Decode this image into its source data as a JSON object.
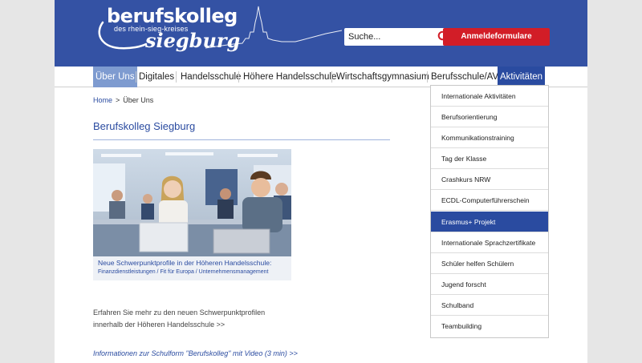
{
  "logo": {
    "line1": "berufskolleg",
    "line2": "des rhein-sieg-kreises",
    "line3": "siegburg"
  },
  "search": {
    "placeholder": "Suche...",
    "icon": "search-icon"
  },
  "header_button": {
    "label": "Anmeldeformulare"
  },
  "nav": {
    "items": [
      {
        "label": "Über Uns"
      },
      {
        "label": "Digitales"
      },
      {
        "label": "Handelsschule"
      },
      {
        "label": "Höhere Handelsschule"
      },
      {
        "label": "Wirtschaftsgymnasium"
      },
      {
        "label": "Berufsschule/AV"
      },
      {
        "label": "Aktivitäten"
      }
    ]
  },
  "breadcrumb": {
    "home": "Home",
    "separator": ">",
    "current": "Über Uns"
  },
  "main": {
    "title": "Berufskolleg Siegburg",
    "teaser": {
      "title": "Neue Schwerpunktprofile in der Höheren Handelsschule:",
      "subtitle": "Finanzdienstleistungen  / Fit für Europa / Unternehmensmanagement"
    },
    "text_line1": "Erfahren Sie mehr zu den neuen Schwerpunktprofilen",
    "text_line2": "innerhalb der Höheren Handelsschule >>",
    "video_link": "Informationen zur Schulform \"Berufskolleg\" mit Video (3 min) >>"
  },
  "dropdown": {
    "items": [
      {
        "label": "Internationale Aktivitäten"
      },
      {
        "label": "Berufsorientierung"
      },
      {
        "label": "Kommunikationstraining"
      },
      {
        "label": "Tag der Klasse"
      },
      {
        "label": "Crashkurs NRW"
      },
      {
        "label": "ECDL-Computerführerschein"
      },
      {
        "label": "Erasmus+ Projekt"
      },
      {
        "label": "Internationale Sprachzertifikate"
      },
      {
        "label": "Schüler helfen Schülern"
      },
      {
        "label": "Jugend forscht"
      },
      {
        "label": "Schulband"
      },
      {
        "label": "Teambuilding"
      }
    ]
  },
  "colors": {
    "header_blue": "#3452a4",
    "nav_active": "#7e9bd0",
    "link_blue": "#2a4ba0",
    "button_red": "#d21d27"
  }
}
